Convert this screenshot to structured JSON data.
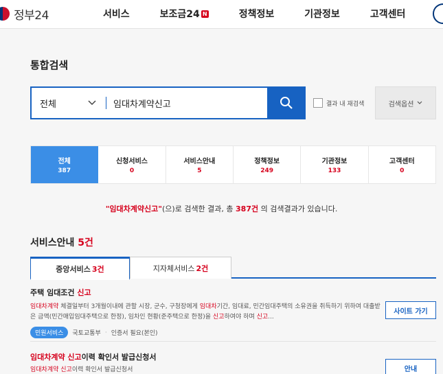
{
  "header": {
    "logo_text": "정부24",
    "menu": [
      {
        "label": "서비스",
        "badge": ""
      },
      {
        "label": "보조금24",
        "badge": "N"
      },
      {
        "label": "정책정보",
        "badge": ""
      },
      {
        "label": "기관정보",
        "badge": ""
      },
      {
        "label": "고객센터",
        "badge": ""
      }
    ]
  },
  "page_title": "통합검색",
  "search": {
    "scope": "전체",
    "query": "임대차계약신고",
    "recheck_label": "결과 내 재검색",
    "options_label": "검색옵션"
  },
  "categories": [
    {
      "label": "전체",
      "count": "387"
    },
    {
      "label": "신청서비스",
      "count": "0"
    },
    {
      "label": "서비스안내",
      "count": "5"
    },
    {
      "label": "정책정보",
      "count": "249"
    },
    {
      "label": "기관정보",
      "count": "133"
    },
    {
      "label": "고객센터",
      "count": "0"
    }
  ],
  "summary": {
    "query_quoted": "\"임대차계약신고\"",
    "mid": "(으)로 검색한 결과, 총 ",
    "total": "387건",
    "tail": " 의 검색결과가 있습니다."
  },
  "section": {
    "title": "서비스안내",
    "count": "5건",
    "tabs": [
      {
        "label": "중앙서비스",
        "count": "3건"
      },
      {
        "label": "지자체서비스",
        "count": "2건"
      }
    ]
  },
  "results": [
    {
      "title_a": "주택 임대조건 ",
      "title_hl": "신고",
      "desc": {
        "p1_hl": "임대차계약",
        "p1": " 체결일부터 3개월이내에 관할 시장, 군수, 구청장에게 ",
        "p2_hl": "임대차",
        "p2": "기간, 임대료, 민간임대주택의 소유권을 취득하기 위하여 대출받은 금액(민간매입임대주택으로 한정), 임차인 현황(준주택으로 한정)을 ",
        "p3_hl": "신고",
        "p3": "하여야 하며 ",
        "p4_hl": "신고",
        "p4": "..."
      },
      "tag": "민원서비스",
      "org": "국토교통부",
      "cert": "인증서 필요(본인)",
      "button": "사이트 가기"
    },
    {
      "title_hl": "임대차계약 신고",
      "title_b": "이력 확인서 발급신청서",
      "desc_hl": "임대차계약 신고",
      "desc": "이력 확인서 발급신청서",
      "button": "안내"
    }
  ]
}
